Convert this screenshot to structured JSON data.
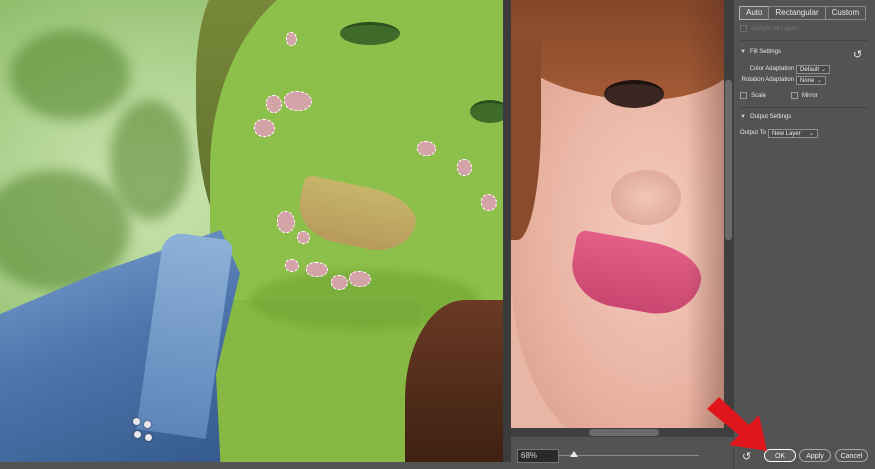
{
  "panel": {
    "modes": [
      {
        "label": "Auto",
        "active": true
      },
      {
        "label": "Rectangular",
        "active": false
      },
      {
        "label": "Custom",
        "active": false
      }
    ],
    "sample_all_layers": "Sample All Layers",
    "fill_settings": {
      "title": "Fill Settings",
      "color_adaptation_label": "Color Adaptation",
      "color_adaptation_value": "Default",
      "rotation_adaptation_label": "Rotation Adaptation",
      "rotation_adaptation_value": "None",
      "scale_label": "Scale",
      "mirror_label": "Mirror"
    },
    "output_settings": {
      "title": "Output Settings",
      "output_to_label": "Output To",
      "output_to_value": "New Layer"
    }
  },
  "preview": {
    "zoom": "68%"
  },
  "buttons": {
    "ok": "OK",
    "apply": "Apply",
    "cancel": "Cancel"
  },
  "colors": {
    "overlay_green": "#8dc04a",
    "arrow_red": "#e0161c"
  }
}
